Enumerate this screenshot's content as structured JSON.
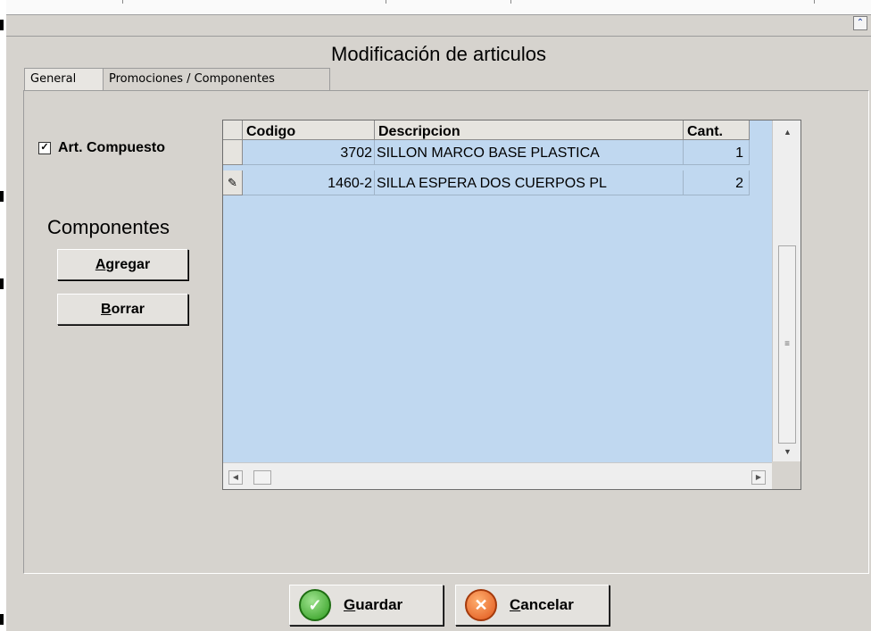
{
  "window": {
    "title": "Modificación de articulos",
    "collapse_icon": "double-chevron-up-icon"
  },
  "tabs": [
    {
      "label": "General",
      "active": false
    },
    {
      "label": "Promociones / Componentes",
      "active": true
    }
  ],
  "compuesto": {
    "label": "Art. Compuesto",
    "checked": true,
    "check_glyph": "✓"
  },
  "componentes": {
    "heading": "Componentes",
    "agregar_accel": "A",
    "agregar_rest": "gregar",
    "borrar_accel": "B",
    "borrar_rest": "orrar"
  },
  "grid": {
    "columns": [
      "Codigo",
      "Descripcion",
      "Cant."
    ],
    "rows": [
      {
        "indicator": "",
        "codigo": "3702",
        "descripcion": "SILLON MARCO BASE PLASTICA",
        "cant": "1"
      },
      {
        "indicator": "✎",
        "codigo": "1460-2",
        "descripcion": "SILLA ESPERA DOS CUERPOS PL",
        "cant": "2"
      }
    ],
    "colors": {
      "background": "#c0d8f0"
    }
  },
  "footer": {
    "guardar_accel": "G",
    "guardar_rest": "uardar",
    "guardar_icon": "checkmark-circle-icon",
    "guardar_glyph": "✓",
    "cancelar_accel": "C",
    "cancelar_rest": "ancelar",
    "cancelar_icon": "cancel-circle-icon",
    "cancelar_glyph": "✕"
  }
}
